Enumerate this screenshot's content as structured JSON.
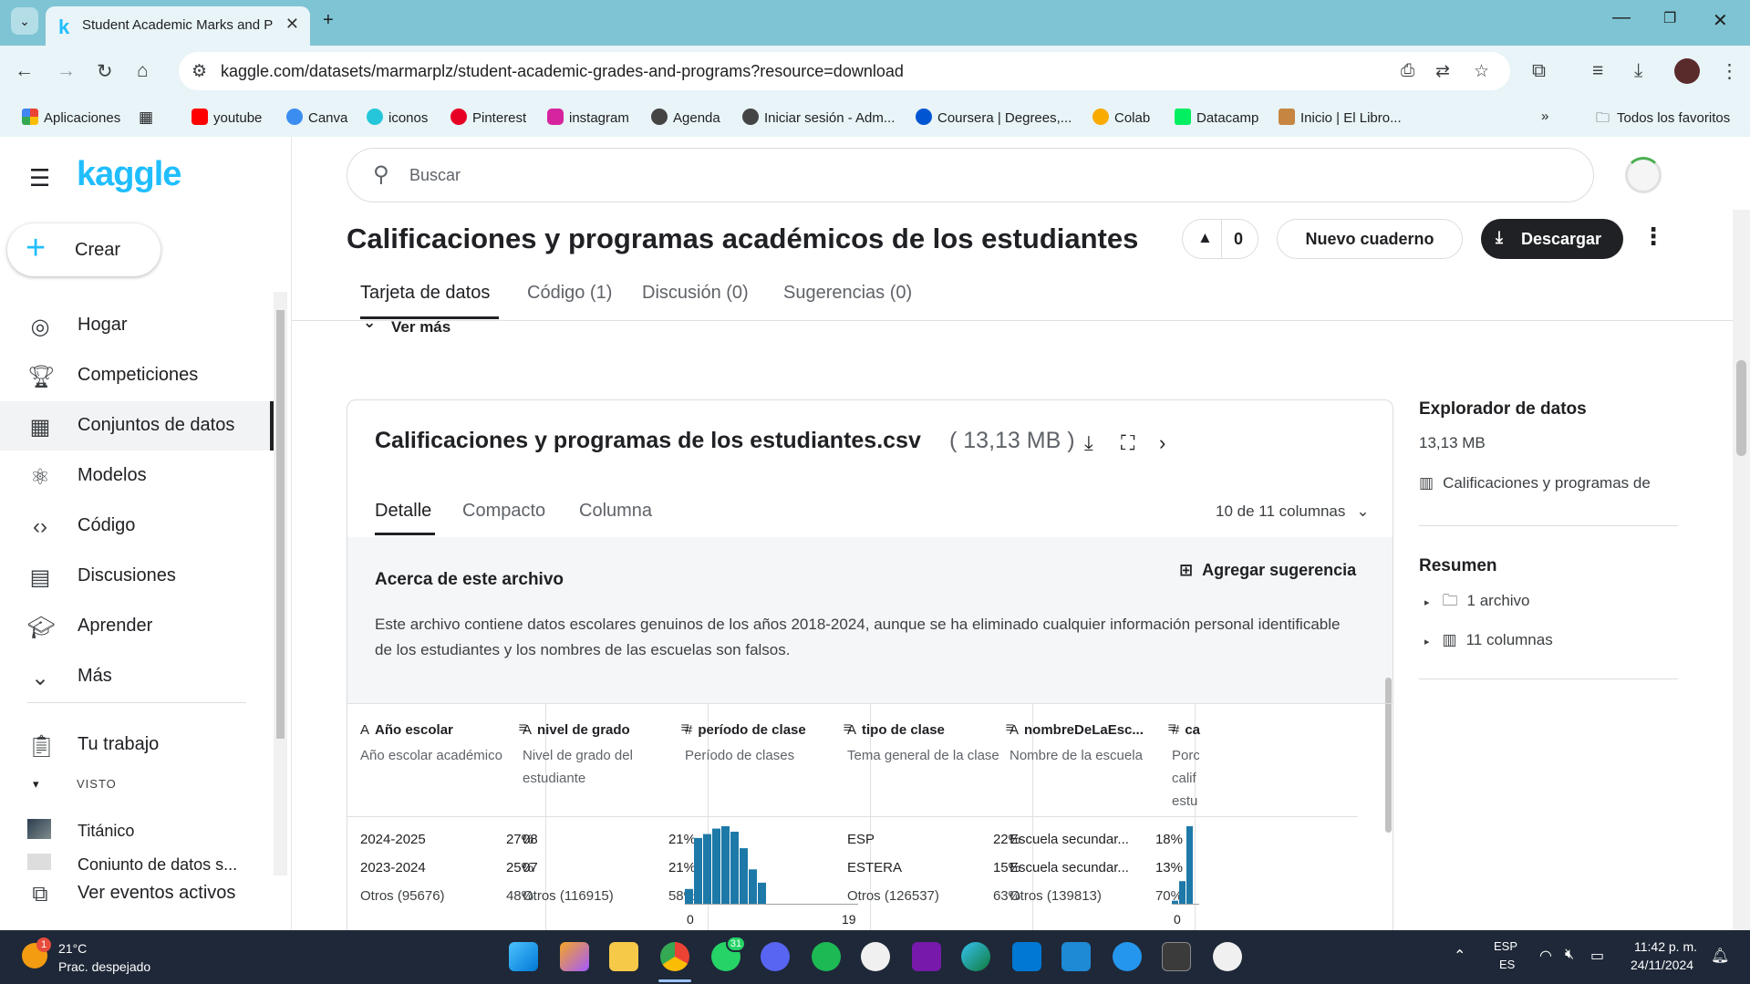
{
  "browser": {
    "tab_title": "Student Academic Marks and P",
    "url": "kaggle.com/datasets/marmarplz/student-academic-grades-and-programs?resource=download",
    "bookmarks": [
      "Aplicaciones",
      "youtube",
      "Canva",
      "iconos",
      "Pinterest",
      "instagram",
      "Agenda",
      "Iniciar sesión - Adm...",
      "Coursera | Degrees,...",
      "Colab",
      "Datacamp",
      "Inicio | El Libro..."
    ],
    "all_bookmarks": "Todos los favoritos"
  },
  "sidebar": {
    "logo": "kaggle",
    "create": "Crear",
    "items": [
      {
        "label": "Hogar",
        "icon": "compass-icon"
      },
      {
        "label": "Competiciones",
        "icon": "trophy-icon"
      },
      {
        "label": "Conjuntos de datos",
        "icon": "table-icon"
      },
      {
        "label": "Modelos",
        "icon": "models-icon"
      },
      {
        "label": "Código",
        "icon": "code-icon"
      },
      {
        "label": "Discusiones",
        "icon": "comments-icon"
      },
      {
        "label": "Aprender",
        "icon": "school-icon"
      },
      {
        "label": "Más",
        "icon": "chevron-down-icon"
      }
    ],
    "your_work": "Tu trabajo",
    "viewed_label": "VISTO",
    "viewed": [
      "Titánico",
      "Conjunto de datos s..."
    ],
    "active_events": "Ver eventos activos"
  },
  "header": {
    "search_placeholder": "Buscar",
    "title": "Calificaciones y programas académicos de los estudiantes",
    "votes": "0",
    "new_notebook": "Nuevo cuaderno",
    "download": "Descargar",
    "tabs": [
      "Tarjeta de datos",
      "Código (1)",
      "Discusión (0)",
      "Sugerencias (0)"
    ],
    "ver_mas": "Ver más"
  },
  "file": {
    "name": "Calificaciones y programas de los estudiantes.csv",
    "size": "( 13,13 MB )",
    "tabs": [
      "Detalle",
      "Compacto",
      "Columna"
    ],
    "columns_selector": "10 de 11 columnas",
    "about_title": "Acerca de este archivo",
    "add_suggestion": "Agregar sugerencia",
    "description": "Este archivo contiene datos escolares genuinos de los años 2018-2024, aunque se ha eliminado cualquier información personal identificable de los estudiantes y los nombres de las escuelas son falsos.",
    "columns": [
      {
        "type": "A",
        "name": "Año escolar",
        "desc": "Año escolar académico",
        "rows": [
          [
            "2024-2025",
            "27%"
          ],
          [
            "2023-2024",
            "25%"
          ],
          [
            "Otros (95676)",
            "48%"
          ]
        ]
      },
      {
        "type": "A",
        "name": "nivel de grado",
        "desc": "Nivel de grado del estudiante",
        "rows": [
          [
            "08",
            "21%"
          ],
          [
            "07",
            "21%"
          ],
          [
            "Otros (116915)",
            "58%"
          ]
        ]
      },
      {
        "type": "#",
        "name": "período de clase",
        "desc": "Período de clases",
        "hist_min": "0",
        "hist_max": "19"
      },
      {
        "type": "A",
        "name": "tipo de clase",
        "desc": "Tema general de la clase",
        "rows": [
          [
            "ESP",
            "22%"
          ],
          [
            "ESTERA",
            "15%"
          ],
          [
            "Otros (126537)",
            "63%"
          ]
        ]
      },
      {
        "type": "A",
        "name": "nombreDeLaEsc...",
        "desc": "Nombre de la escuela",
        "rows": [
          [
            "Escuela secundar...",
            "18%"
          ],
          [
            "Escuela secundar...",
            "13%"
          ],
          [
            "Otros (139813)",
            "70%"
          ]
        ]
      },
      {
        "type": "#",
        "name": "ca",
        "desc": "Porc calif estu",
        "hist_min": "0"
      }
    ]
  },
  "chart_data": [
    {
      "type": "bar",
      "title": "",
      "xlabel": "",
      "ylabel": "",
      "x_range_labels": [
        "0",
        "19"
      ],
      "values": [
        0.2,
        0.85,
        0.9,
        0.97,
        1.0,
        0.93,
        0.72,
        0.45,
        0.28
      ]
    },
    {
      "type": "bar",
      "title": "",
      "x_range_labels": [
        "0"
      ],
      "values": [
        0.05,
        0.3,
        1.0
      ]
    }
  ],
  "right_panel": {
    "explorer_title": "Explorador de datos",
    "explorer_size": "13,13 MB",
    "explorer_file": "Calificaciones y programas de",
    "summary_title": "Resumen",
    "summary_items": [
      "1 archivo",
      "11 columnas"
    ]
  },
  "taskbar": {
    "weather_temp": "21°C",
    "weather_desc": "Prac. despejado",
    "whatsapp_badge": "31",
    "lang_top": "ESP",
    "lang_bottom": "ES",
    "time": "11:42 p. m.",
    "date": "24/11/2024"
  },
  "colors": {
    "kaggle_blue": "#20beff",
    "chrome_teal": "#7ec4d4",
    "bar": "#1d79a8",
    "taskbar": "#1e2838"
  }
}
